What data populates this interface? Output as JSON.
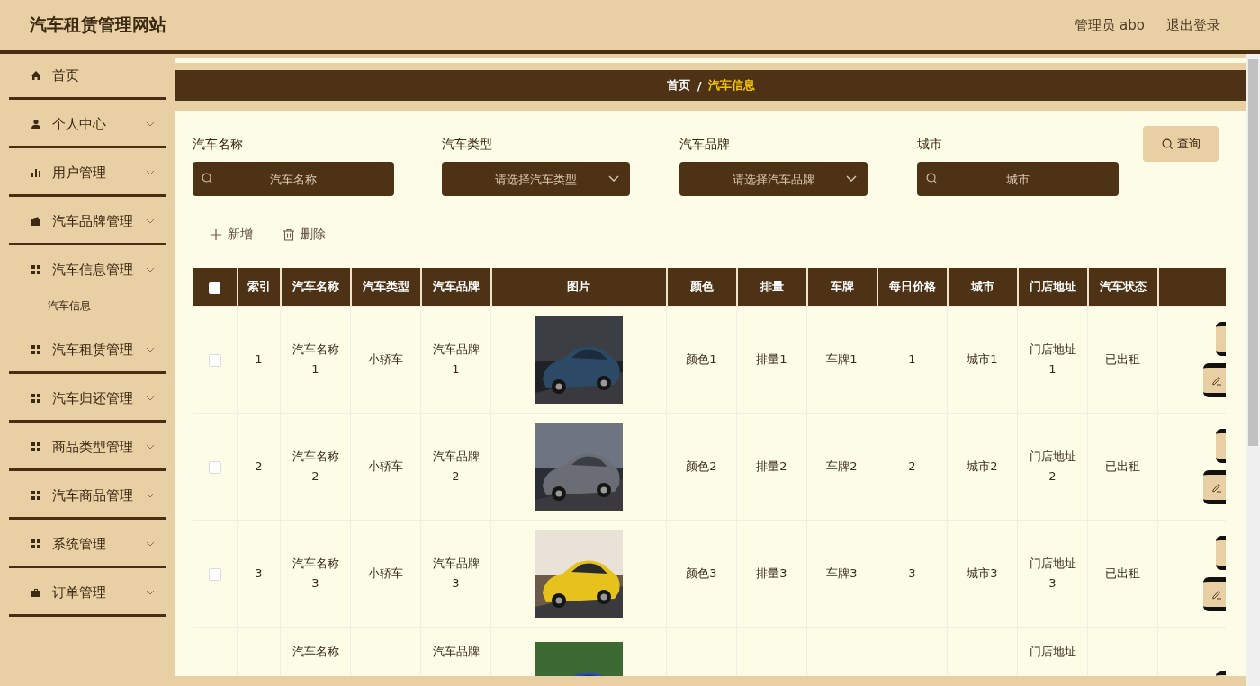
{
  "header": {
    "title": "汽车租赁管理网站",
    "user": "管理员 abo",
    "logout": "退出登录"
  },
  "sidebar": {
    "items": [
      {
        "label": "首页",
        "kind": "link"
      },
      {
        "label": "个人中心",
        "kind": "menu"
      },
      {
        "label": "用户管理",
        "kind": "menu"
      },
      {
        "label": "汽车品牌管理",
        "kind": "menu"
      },
      {
        "label": "汽车信息管理",
        "kind": "menu",
        "children": [
          {
            "label": "汽车信息"
          }
        ]
      },
      {
        "label": "汽车租赁管理",
        "kind": "menu"
      },
      {
        "label": "汽车归还管理",
        "kind": "menu"
      },
      {
        "label": "商品类型管理",
        "kind": "menu"
      },
      {
        "label": "汽车商品管理",
        "kind": "menu"
      },
      {
        "label": "系统管理",
        "kind": "menu"
      },
      {
        "label": "订单管理",
        "kind": "menu"
      }
    ]
  },
  "breadcrumb": {
    "separator": "/",
    "items": [
      {
        "label": "首页",
        "current": false
      },
      {
        "label": "汽车信息",
        "current": true
      }
    ]
  },
  "search": {
    "fields": [
      {
        "label": "汽车名称",
        "kind": "text",
        "placeholder": "汽车名称"
      },
      {
        "label": "汽车类型",
        "kind": "select",
        "placeholder": "请选择汽车类型"
      },
      {
        "label": "汽车品牌",
        "kind": "select",
        "placeholder": "请选择汽车品牌"
      },
      {
        "label": "城市",
        "kind": "text",
        "placeholder": "城市"
      }
    ],
    "button": "查询"
  },
  "actions": [
    {
      "label": "新增",
      "kind": "add"
    },
    {
      "label": "删除",
      "kind": "delete"
    }
  ],
  "table": {
    "select_all_checked": false,
    "columns": [
      "索引",
      "汽车名称",
      "汽车类型",
      "汽车品牌",
      "图片",
      "颜色",
      "排量",
      "车牌",
      "每日价格",
      "城市",
      "门店地址",
      "汽车状态"
    ],
    "rows": [
      {
        "checked": false,
        "cells": [
          "1",
          "汽车名称1",
          "小轿车",
          "汽车品牌1",
          null,
          "颜色1",
          "排量1",
          "车牌1",
          "1",
          "城市1",
          "门店地址1",
          "已出租"
        ]
      },
      {
        "checked": false,
        "cells": [
          "2",
          "汽车名称2",
          "小轿车",
          "汽车品牌2",
          null,
          "颜色2",
          "排量2",
          "车牌2",
          "2",
          "城市2",
          "门店地址2",
          "已出租"
        ]
      },
      {
        "checked": false,
        "cells": [
          "3",
          "汽车名称3",
          "小轿车",
          "汽车品牌3",
          null,
          "颜色3",
          "排量3",
          "车牌3",
          "3",
          "城市3",
          "门店地址3",
          "已出租"
        ]
      },
      {
        "cells": [
          null,
          "汽车名称",
          null,
          "汽车品牌",
          null,
          null,
          null,
          null,
          null,
          null,
          "门店地址",
          null
        ]
      }
    ]
  }
}
